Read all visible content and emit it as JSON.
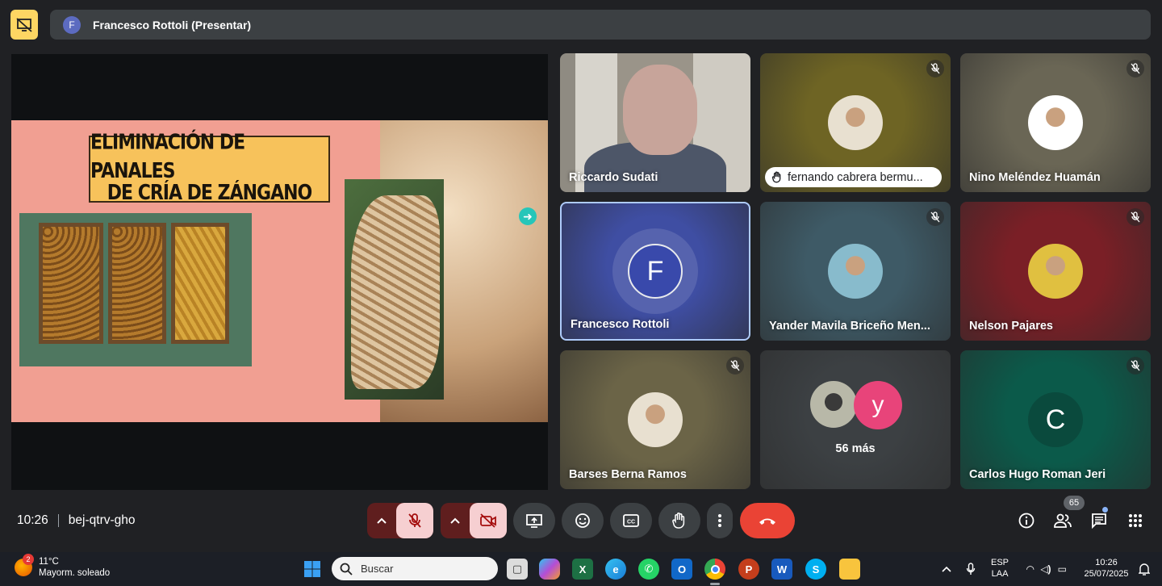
{
  "top_bar": {
    "presenter_initial": "F",
    "presenter_label": "Francesco Rottoli (Presentar)",
    "no_present_icon": "presentation-off-icon"
  },
  "slide": {
    "title_line1": "ELIMINACIÓN DE PANALES",
    "title_line2": "DE CRÍA DE ZÁNGANO"
  },
  "tiles": [
    {
      "name": "Riccardo Sudati",
      "muted": false,
      "kind": "video",
      "color": "#6f6f6a"
    },
    {
      "name": "fernando cabrera bermu...",
      "muted": true,
      "kind": "avatar",
      "raised_hand": true,
      "color": "#6e6424"
    },
    {
      "name": "Nino Meléndez Huamán",
      "muted": true,
      "kind": "avatar",
      "color": "#6a6655"
    },
    {
      "name": "Francesco Rottoli",
      "muted": false,
      "kind": "initial",
      "initial": "F",
      "color": "#3f4ea3"
    },
    {
      "name": "Yander Mavila Briceño Men...",
      "muted": true,
      "kind": "avatar",
      "color": "#3e5a66"
    },
    {
      "name": "Nelson Pajares",
      "muted": true,
      "kind": "avatar",
      "color": "#7a1f26"
    },
    {
      "name": "Barses Berna Ramos",
      "muted": true,
      "kind": "avatar",
      "color": "#6b6447"
    },
    {
      "name": "",
      "more_label": "56 más",
      "more_initial": "y",
      "kind": "more",
      "color": "#3c4043"
    },
    {
      "name": "Carlos Hugo Roman Jeri",
      "muted": true,
      "kind": "initial",
      "initial": "C",
      "color": "#0b5a4a"
    }
  ],
  "controls": {
    "time": "10:26",
    "meeting_code": "bej-qtrv-gho",
    "participants_count": "65"
  },
  "taskbar": {
    "weather_temp": "11°C",
    "weather_desc": "Mayorm. soleado",
    "weather_badge": "2",
    "search_placeholder": "Buscar",
    "lang_line1": "ESP",
    "lang_line2": "LAA",
    "clock_time": "10:26",
    "clock_date": "25/07/2025"
  }
}
